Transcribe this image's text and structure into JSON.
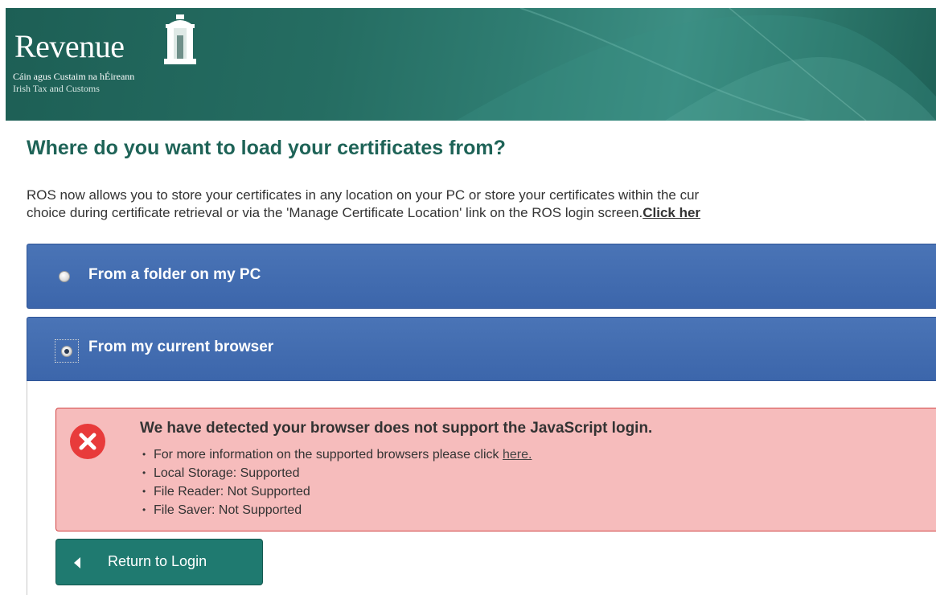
{
  "header": {
    "logo_word": "Revenue",
    "subtitle_irish": "Cáin agus Custaim na hÉireann",
    "subtitle_english": "Irish Tax and Customs",
    "icon": "government-building-icon",
    "colors": {
      "header": "#256d62",
      "text": "#ffffff"
    }
  },
  "main": {
    "title": "Where do you want to load your certificates from?",
    "intro_line1": "ROS now allows you to store your certificates in any location on your PC or store your certificates within the cur",
    "intro_line2": "choice during certificate retrieval or via the 'Manage Certificate Location' link on the ROS login screen.",
    "intro_link": "Click her"
  },
  "options": [
    {
      "label": "From a folder on my PC",
      "selected": false
    },
    {
      "label": "From my current browser",
      "selected": true
    }
  ],
  "alert": {
    "title": "We have detected your browser does not support the JavaScript login.",
    "info_prefix": "For more information on the supported browsers please click ",
    "info_link": "here.",
    "items": [
      "Local Storage: Supported",
      "File Reader: Not Supported",
      "File Saver: Not Supported"
    ],
    "icon": "error-x-icon",
    "colors": {
      "background": "#f6bcbc",
      "border": "#d24545",
      "icon": "#e83b3b"
    }
  },
  "button": {
    "label": "Return to Login",
    "icon": "chevron-left-icon",
    "color": "#1f7a70"
  },
  "colors": {
    "title": "#1e6357",
    "panel": "#4470b3"
  }
}
